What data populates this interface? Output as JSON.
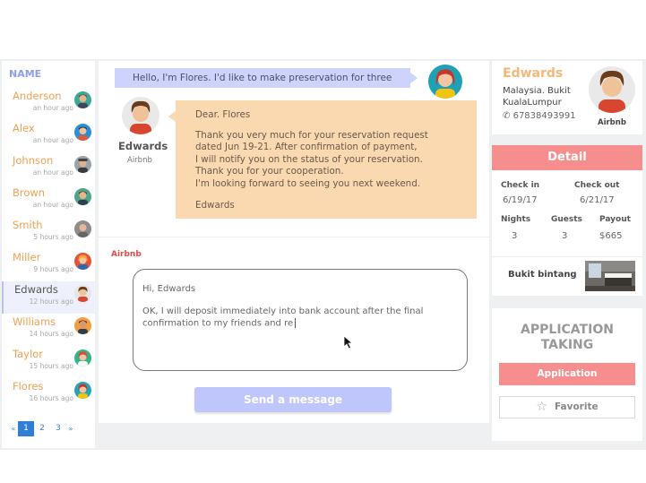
{
  "sidebar": {
    "title": "NAME",
    "contacts": [
      {
        "name": "Anderson",
        "time": "an hour ago",
        "avatar": "man-avatar-teal"
      },
      {
        "name": "Alex",
        "time": "an hour ago",
        "avatar": "man-avatar-blue"
      },
      {
        "name": "Johnson",
        "time": "an hour ago",
        "avatar": "man-avatar-gray"
      },
      {
        "name": "Brown",
        "time": "an hour ago",
        "avatar": "man-avatar-green"
      },
      {
        "name": "Smith",
        "time": "5 hours ago",
        "avatar": "man-avatar-bald"
      },
      {
        "name": "Miller",
        "time": "9 hours ago",
        "avatar": "woman-avatar-red"
      },
      {
        "name": "Edwards",
        "time": "12 hours ago",
        "avatar": "man-avatar-orange"
      },
      {
        "name": "Williams",
        "time": "14 hours ago",
        "avatar": "man-avatar-orange"
      },
      {
        "name": "Taylor",
        "time": "15 hours ago",
        "avatar": "woman-avatar-green"
      },
      {
        "name": "Flores",
        "time": "16 hours ago",
        "avatar": "woman-avatar-teal"
      }
    ],
    "active_index": 6,
    "pager": {
      "prev": "«",
      "pages": [
        "1",
        "2",
        "3"
      ],
      "current": "1",
      "next": "»"
    }
  },
  "chat": {
    "user_message": "Hello, I'm Flores. I'd like to make preservation for three",
    "host_name": "Edwards",
    "host_sub": "Airbnb",
    "host_message": {
      "greeting": "Dear. Flores",
      "lines": [
        "Thank you very much for your reservation request",
        "dated Jun 19-21.  After confirmation of payment,",
        "I will notify you on the status of your reservation.",
        "Thank you for your cooperation.",
        " I'm looking forward to seeing you next weekend."
      ],
      "signature": "Edwards"
    },
    "reply_label": "Airbnb",
    "reply_greeting": "Hi, Edwards",
    "reply_text": "OK, I will deposit immediately into bank account after the final confirmation to my friends and re",
    "send_label": "Send a message"
  },
  "profile": {
    "name": "Edwards",
    "location_line1": "Malaysia. Bukit",
    "location_line2": "KualaLumpur",
    "phone": "67838493991",
    "brand": "Airbnb"
  },
  "detail": {
    "title": "Detail",
    "checkin_label": "Check in",
    "checkin": "6/19/17",
    "checkout_label": "Check out",
    "checkout": "6/21/17",
    "nights_label": "Nights",
    "nights": "3",
    "guests_label": "Guests",
    "guests": "3",
    "payout_label": "Payout",
    "payout": "$665",
    "place": "Bukit bintang"
  },
  "application": {
    "title_line1": "APPLICATION",
    "title_line2": "TAKING",
    "apply_label": "Application",
    "favorite_label": "Favorite"
  },
  "colors": {
    "accent_orange": "#f0a050",
    "accent_red": "#f68e8e",
    "user_bubble": "#cdd3fa",
    "host_bubble": "#fad8b0",
    "link_blue": "#2f7fd6"
  }
}
